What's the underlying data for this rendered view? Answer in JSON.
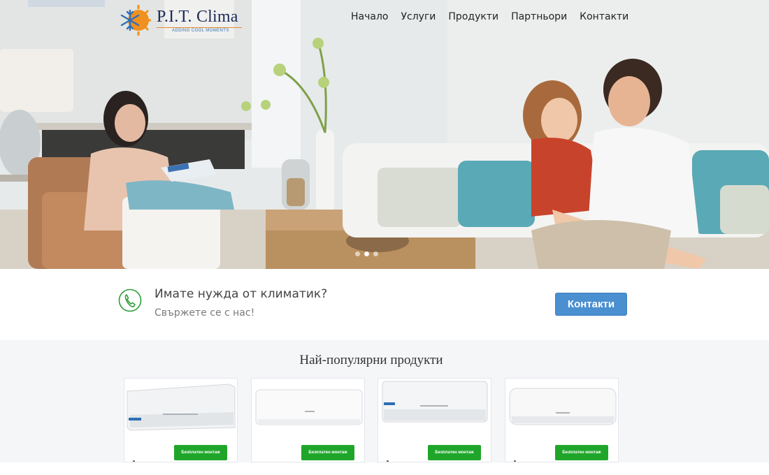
{
  "brand": {
    "name": "P.I.T. Clima",
    "tagline": "ADDING COOL MOMENTS",
    "colors": {
      "navy": "#1d2b5a",
      "orange": "#f0901e",
      "blue": "#2f6fb6"
    }
  },
  "nav": {
    "items": [
      "Начало",
      "Услуги",
      "Продукти",
      "Партньори",
      "Контакти"
    ]
  },
  "hero": {
    "slides_total": 3,
    "active_slide": 2
  },
  "call": {
    "icon": "phone-icon",
    "title": "Имате нужда от климатик?",
    "subtitle": "Свържете се с нас!",
    "button_label": "Контакти",
    "button_color": "#4a8fd0",
    "icon_color": "#2e9e3a"
  },
  "products": {
    "title": "Най-популярни продукти",
    "badge_color": "#1fa62a",
    "items": [
      {
        "badge": "Безплатен монтаж"
      },
      {
        "badge": "Безплатен монтаж"
      },
      {
        "badge": "Безплатен монтаж"
      },
      {
        "badge": "Безплатен монтаж"
      }
    ]
  }
}
